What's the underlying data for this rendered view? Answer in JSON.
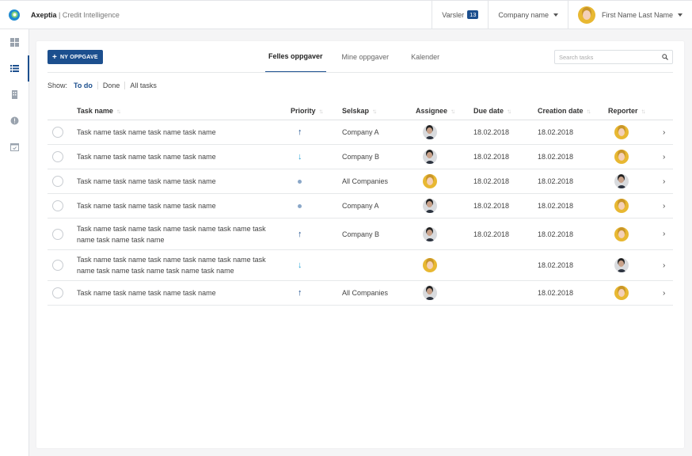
{
  "header": {
    "brand_name": "Axeptia",
    "brand_product": "Credit Intelligence",
    "notifications_label": "Varsler",
    "notifications_count": "13",
    "company_select": "Company name",
    "user_name": "First Name Last Name"
  },
  "sidebar": {
    "items": [
      {
        "icon": "dashboard-icon",
        "active": false
      },
      {
        "icon": "task-list-icon",
        "active": true
      },
      {
        "icon": "building-icon",
        "active": false
      },
      {
        "icon": "alert-icon",
        "active": false
      },
      {
        "icon": "calendar-icon",
        "active": false
      }
    ]
  },
  "toolbar": {
    "new_task_label": "NY OPPGAVE",
    "tabs": [
      "Felles oppgaver",
      "Mine oppgaver",
      "Kalender"
    ],
    "active_tab": 0,
    "search_placeholder": "Search tasks"
  },
  "filter": {
    "label": "Show:",
    "options": [
      "To do",
      "Done",
      "All tasks"
    ],
    "active": 0
  },
  "table": {
    "columns": [
      "Task name",
      "Priority",
      "Selskap",
      "Assignee",
      "Due date",
      "Creation date",
      "Reporter"
    ],
    "rows": [
      {
        "name": "Task name task name task name task name",
        "priority": "high",
        "company": "Company A",
        "assignee": "male",
        "due": "18.02.2018",
        "created": "18.02.2018",
        "reporter": "female"
      },
      {
        "name": "Task name task name task name task name",
        "priority": "low",
        "company": "Company B",
        "assignee": "male",
        "due": "18.02.2018",
        "created": "18.02.2018",
        "reporter": "female"
      },
      {
        "name": "Task name task name task name task name",
        "priority": "medium",
        "company": "All Companies",
        "assignee": "female",
        "due": "18.02.2018",
        "created": "18.02.2018",
        "reporter": "male"
      },
      {
        "name": "Task name task name task name task name",
        "priority": "medium",
        "company": "Company A",
        "assignee": "male",
        "due": "18.02.2018",
        "created": "18.02.2018",
        "reporter": "female"
      },
      {
        "name": "Task name task name task name task name task name task name task name task name",
        "priority": "high",
        "company": "Company B",
        "assignee": "male",
        "due": "18.02.2018",
        "created": "18.02.2018",
        "reporter": "female"
      },
      {
        "name": "Task name task name task name task name task name task name task name task name task name task name",
        "priority": "low",
        "company": "",
        "assignee": "female",
        "due": "",
        "created": "18.02.2018",
        "reporter": "male"
      },
      {
        "name": "Task name task name task name task name",
        "priority": "high",
        "company": "All Companies",
        "assignee": "male",
        "due": "",
        "created": "18.02.2018",
        "reporter": "female"
      }
    ]
  },
  "colors": {
    "accent": "#1c4f8e",
    "priority_low": "#29a3d6",
    "priority_medium": "#8aa7c8"
  }
}
